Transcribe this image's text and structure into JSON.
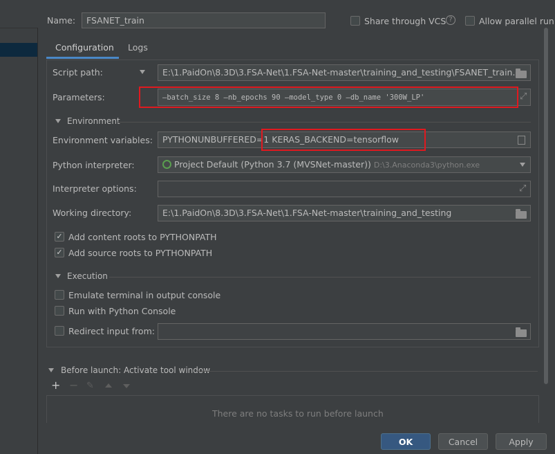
{
  "header": {
    "name_label": "Name:",
    "name_value": "FSANET_train",
    "share_vcs_label": "Share through VCS",
    "help_icon": "?",
    "allow_parallel_label": "Allow parallel run"
  },
  "tabs": [
    {
      "label": "Configuration",
      "active": true
    },
    {
      "label": "Logs",
      "active": false
    }
  ],
  "config": {
    "script_path_label": "Script path:",
    "script_path_value": "E:\\1.PaidOn\\8.3D\\3.FSA-Net\\1.FSA-Net-master\\training_and_testing\\FSANET_train.py",
    "parameters_label": "Parameters:",
    "parameters_value": "—batch_size 8 —nb_epochs 90 —model_type 0 —db_name '300W_LP'",
    "environment_section": "Environment",
    "env_vars_label": "Environment variables:",
    "env_vars_value_a": "PYTHONUNBUFFERED=1",
    "env_vars_value_b": "KERAS_BACKEND=tensorflow",
    "interpreter_label": "Python interpreter:",
    "interpreter_value": "Project Default (Python 3.7 (MVSNet-master))",
    "interpreter_path": "D:\\3.Anaconda3\\python.exe",
    "interpreter_options_label": "Interpreter options:",
    "interpreter_options_value": "",
    "working_dir_label": "Working directory:",
    "working_dir_value": "E:\\1.PaidOn\\8.3D\\3.FSA-Net\\1.FSA-Net-master\\training_and_testing",
    "add_content_roots_label": "Add content roots to PYTHONPATH",
    "add_content_roots_checked": true,
    "add_source_roots_label": "Add source roots to PYTHONPATH",
    "add_source_roots_checked": true,
    "execution_section": "Execution",
    "emulate_terminal_label": "Emulate terminal in output console",
    "run_python_console_label": "Run with Python Console",
    "redirect_input_label": "Redirect input from:",
    "redirect_input_value": ""
  },
  "before_launch": {
    "title": "Before launch: Activate tool window",
    "empty_text": "There are no tasks to run before launch"
  },
  "footer": {
    "ok_label": "OK",
    "cancel_label": "Cancel",
    "apply_label": "Apply"
  },
  "colors": {
    "background": "#3c3f41",
    "field": "#45494a",
    "primary_button": "#365880",
    "highlight_box": "#e0191f"
  }
}
